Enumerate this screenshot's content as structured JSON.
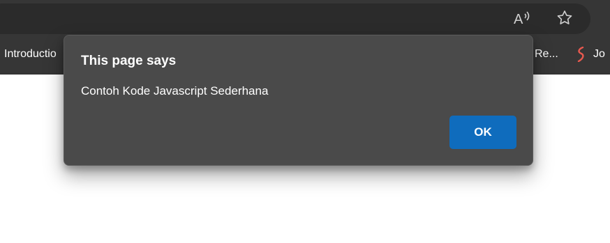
{
  "toolbar": {
    "icons": [
      "read-aloud-icon",
      "favorite-star-icon"
    ]
  },
  "bookmarks": {
    "items": [
      {
        "label": "Introductio"
      },
      {
        "label": "Re..."
      },
      {
        "label": "Jo"
      }
    ]
  },
  "dialog": {
    "title": "This page says",
    "message": "Contoh Kode Javascript Sederhana",
    "ok_label": "OK",
    "ok_color": "#0f6cbd",
    "background": "#4a4a4a"
  }
}
